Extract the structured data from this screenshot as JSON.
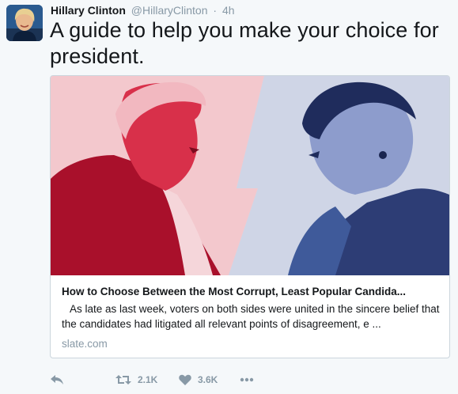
{
  "tweet": {
    "author": {
      "full_name": "Hillary Clinton",
      "handle": "@HillaryClinton",
      "separator": "·",
      "time": "4h",
      "avatar_icon": "profile-photo"
    },
    "text": "A guide to help you make your choice for president.",
    "card": {
      "image_icon": "split-portrait-red-blue",
      "title": "How to Choose Between the Most Corrupt, Least Popular Candida...",
      "description": "As late as last week, voters on both sides were united in the sincere belief that the candidates had litigated all relevant points of disagreement, e ...",
      "domain": "slate.com"
    },
    "actions": {
      "reply_icon": "reply-icon",
      "retweet_icon": "retweet-icon",
      "retweet_count": "2.1K",
      "like_icon": "heart-icon",
      "like_count": "3.6K",
      "more_icon": "more-icon"
    },
    "colors": {
      "background": "#f5f8fa",
      "text": "#14171a",
      "muted": "#8899a6",
      "card_border": "#ccd6dd",
      "image_red": "#c8102e",
      "image_blue": "#3a4f8f"
    }
  }
}
